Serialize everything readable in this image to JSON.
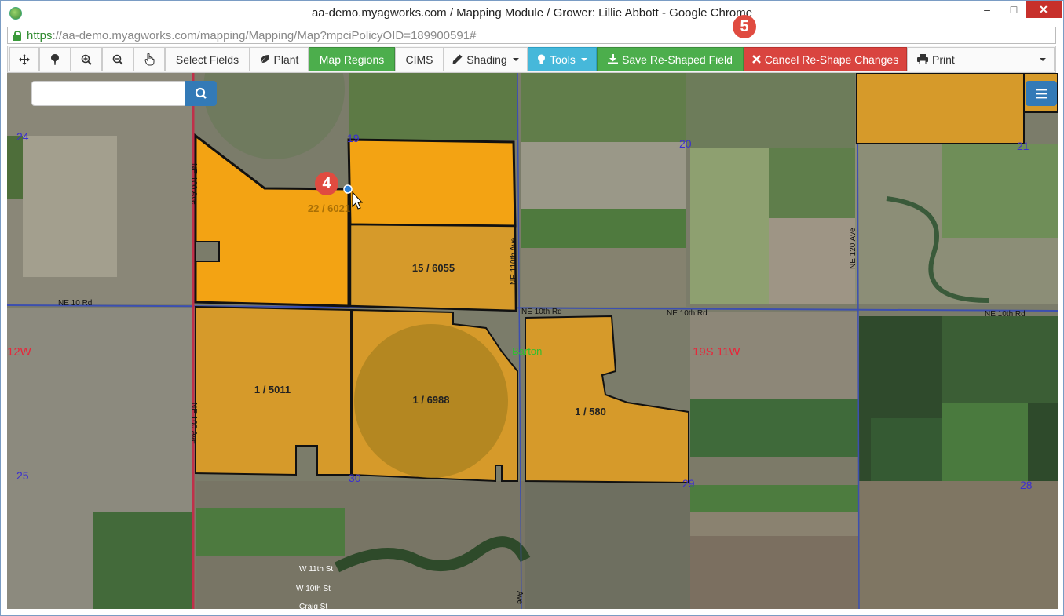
{
  "window": {
    "title": "aa-demo.myagworks.com / Mapping Module / Grower: Lillie Abbott - Google Chrome",
    "minimize": "–",
    "maximize": "□",
    "close": "✕"
  },
  "address_bar": {
    "scheme": "https",
    "rest": "://aa-demo.myagworks.com/mapping/Mapping/Map?mpciPolicyOID=189900591#"
  },
  "toolbar": {
    "select_fields": "Select Fields",
    "plant": "Plant",
    "map_regions": "Map Regions",
    "cims": "CIMS",
    "shading": "Shading",
    "tools": "Tools",
    "save_reshaped": "Save Re-Shaped Field",
    "cancel_reshape": "Cancel Re-Shape Changes",
    "print": "Print"
  },
  "callouts": {
    "step4": "4",
    "step5": "5"
  },
  "map": {
    "sections": {
      "s24": "24",
      "s20": "20",
      "s21": "21",
      "s25": "25",
      "s30": "30",
      "s29": "29",
      "s28": "28",
      "s19": "19"
    },
    "townships": {
      "west": "12W",
      "center": "19S 11W"
    },
    "town": "Barton",
    "roads": {
      "ne10rd": "NE 10 Rd",
      "ne10th_a": "NE 10th Rd",
      "ne10th_b": "NE 10th Rd",
      "ne10th_c": "NE 10th Rd",
      "ne110": "NE 110th Ave",
      "ne120": "NE 120 Ave",
      "ne100_top": "NE 100 Ave",
      "ne100_bottom": "NE 100 Ave",
      "w11": "W 11th St",
      "w10": "W 10th St",
      "craig": "Craig St",
      "ave": "Ave"
    },
    "fields": {
      "top_left": "22 / 6021",
      "top_mid": "15 / 6055",
      "bottom_left": "1 / 5011",
      "bottom_mid": "1 / 6988",
      "bottom_right": "1 / 580"
    }
  },
  "colors": {
    "field_selected": "#f3a313",
    "field_normal": "#d69a2a",
    "toolbar_green": "#4cae4c",
    "toolbar_teal": "#46b8da",
    "toolbar_red": "#d9443f",
    "search_blue": "#337ab7",
    "callout_red": "#e04b40"
  },
  "icons": {
    "pan": "move-icon",
    "pin": "pin-icon",
    "zoom_in": "zoom-in-icon",
    "zoom_out": "zoom-out-icon",
    "pointer": "hand-pointer-icon",
    "search": "search-icon",
    "layers": "layers-menu-icon",
    "lock": "lock-icon"
  }
}
